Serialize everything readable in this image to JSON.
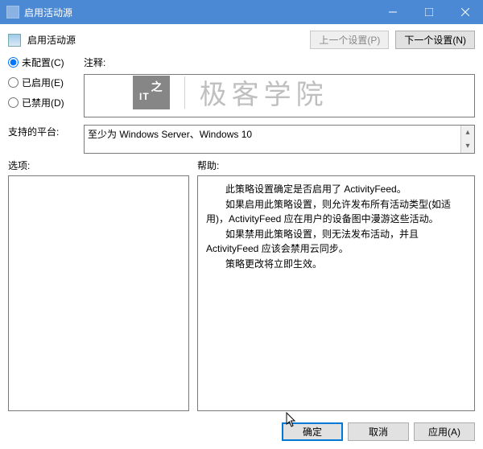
{
  "window": {
    "title": "启用活动源"
  },
  "header": {
    "policy_name": "启用活动源",
    "prev_btn": "上一个设置(P)",
    "next_btn": "下一个设置(N)"
  },
  "state": {
    "not_configured": "未配置(C)",
    "enabled": "已启用(E)",
    "disabled": "已禁用(D)",
    "selected": "not_configured"
  },
  "labels": {
    "comment": "注释:",
    "platform": "支持的平台:",
    "options": "选项:",
    "help": "帮助:"
  },
  "platform_text": "至少为 Windows Server、Windows 10",
  "help": {
    "p1": "此策略设置确定是否启用了 ActivityFeed。",
    "p2": "如果启用此策略设置，则允许发布所有活动类型(如适用)，ActivityFeed 应在用户的设备图中漫游这些活动。",
    "p3": "如果禁用此策略设置，则无法发布活动，并且 ActivityFeed 应该会禁用云同步。",
    "p4": "策略更改将立即生效。"
  },
  "footer": {
    "ok": "确定",
    "cancel": "取消",
    "apply": "应用(A)"
  },
  "watermark": {
    "badge": "IT",
    "text": "极客学院"
  }
}
